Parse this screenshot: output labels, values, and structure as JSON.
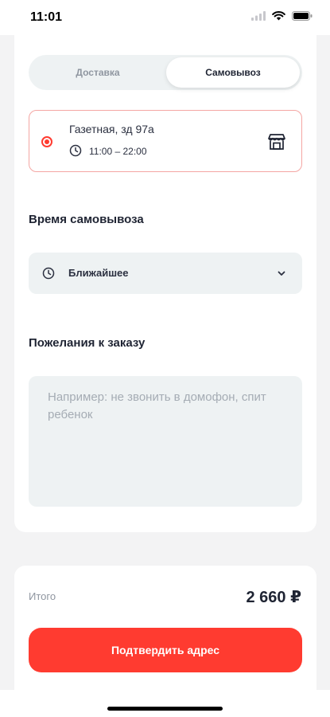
{
  "status_bar": {
    "time": "11:01"
  },
  "delivery_toggle": {
    "options": [
      "Доставка",
      "Самовывоз"
    ],
    "selected": "Самовывоз"
  },
  "pickup_point": {
    "address": "Газетная, зд 97а",
    "hours": "11:00 – 22:00"
  },
  "pickup_time": {
    "title": "Время самовывоза",
    "selected": "Ближайшее"
  },
  "order_notes": {
    "title": "Пожелания к заказу",
    "placeholder": "Например: не звонить в домофон, спит ребенок",
    "value": ""
  },
  "summary": {
    "total_label": "Итого",
    "total_value": "2 660 ₽"
  },
  "confirm_button": {
    "label": "Подтвердить адрес"
  },
  "colors": {
    "accent": "#ff3b30",
    "accent_border": "#f4a6a3",
    "field_bg": "#eef2f3",
    "text": "#1f2433",
    "muted": "#8f96a0"
  },
  "icons": [
    "signal-icon",
    "wifi-icon",
    "battery-icon",
    "radio-selected-icon",
    "clock-icon",
    "store-icon",
    "chevron-down-icon"
  ]
}
